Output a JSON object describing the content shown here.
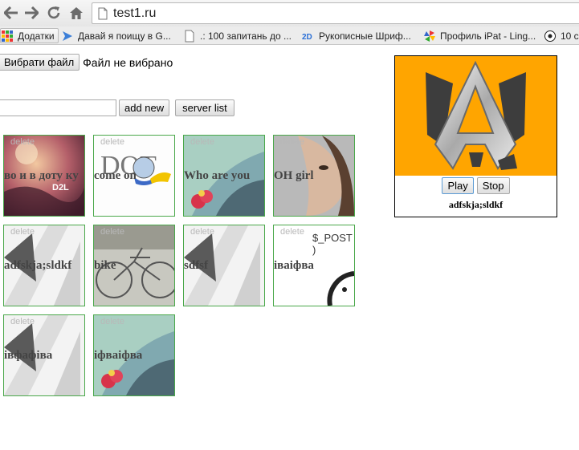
{
  "browser": {
    "url": "test1.ru",
    "bookmarks": [
      {
        "label": "Додатки",
        "icon": "apps-grid-icon"
      },
      {
        "label": "Давай я поищу в G...",
        "icon": "arrow-icon"
      },
      {
        "label": ".: 100 запитань до ...",
        "icon": "page-icon"
      },
      {
        "label": "Рукописные Шриф...",
        "icon": "2d-logo-icon"
      },
      {
        "label": "Профиль iPat - Ling...",
        "icon": "pinwheel-icon"
      },
      {
        "label": "10 с",
        "icon": "football-icon"
      }
    ]
  },
  "upload": {
    "choose_label": "Вибрати файл",
    "status": "Файл не вибрано"
  },
  "add_form": {
    "input_value": "",
    "add_label": "add new",
    "server_label": "server list"
  },
  "tracks": [
    {
      "title": "во и в доту ку",
      "delete": "delete",
      "art": "d2l"
    },
    {
      "title": "come on",
      "delete": "delete",
      "art": "dota-logo"
    },
    {
      "title": "Who are you",
      "delete": "delete",
      "art": "flower"
    },
    {
      "title": "OH girl",
      "delete": "delete",
      "art": "girl"
    },
    {
      "title": "adfskja;sldkf",
      "delete": "delete",
      "art": "silver-a"
    },
    {
      "title": "bike",
      "delete": "delete",
      "art": "bike"
    },
    {
      "title": "sdfsf",
      "delete": "delete",
      "art": "silver-a"
    },
    {
      "title": "іваіфва",
      "delete": "delete",
      "art": "post",
      "extra": "$_POST )"
    },
    {
      "title": "івфафіва",
      "delete": "delete",
      "art": "silver-a"
    },
    {
      "title": "іфваіфва",
      "delete": "delete",
      "art": "flower"
    }
  ],
  "player": {
    "play_label": "Play",
    "stop_label": "Stop",
    "title": "adfskja;sldkf",
    "cover_color": "#ffa500"
  },
  "colors": {
    "tile_border": "#4aa84a",
    "page_bg": "#ffffff"
  }
}
